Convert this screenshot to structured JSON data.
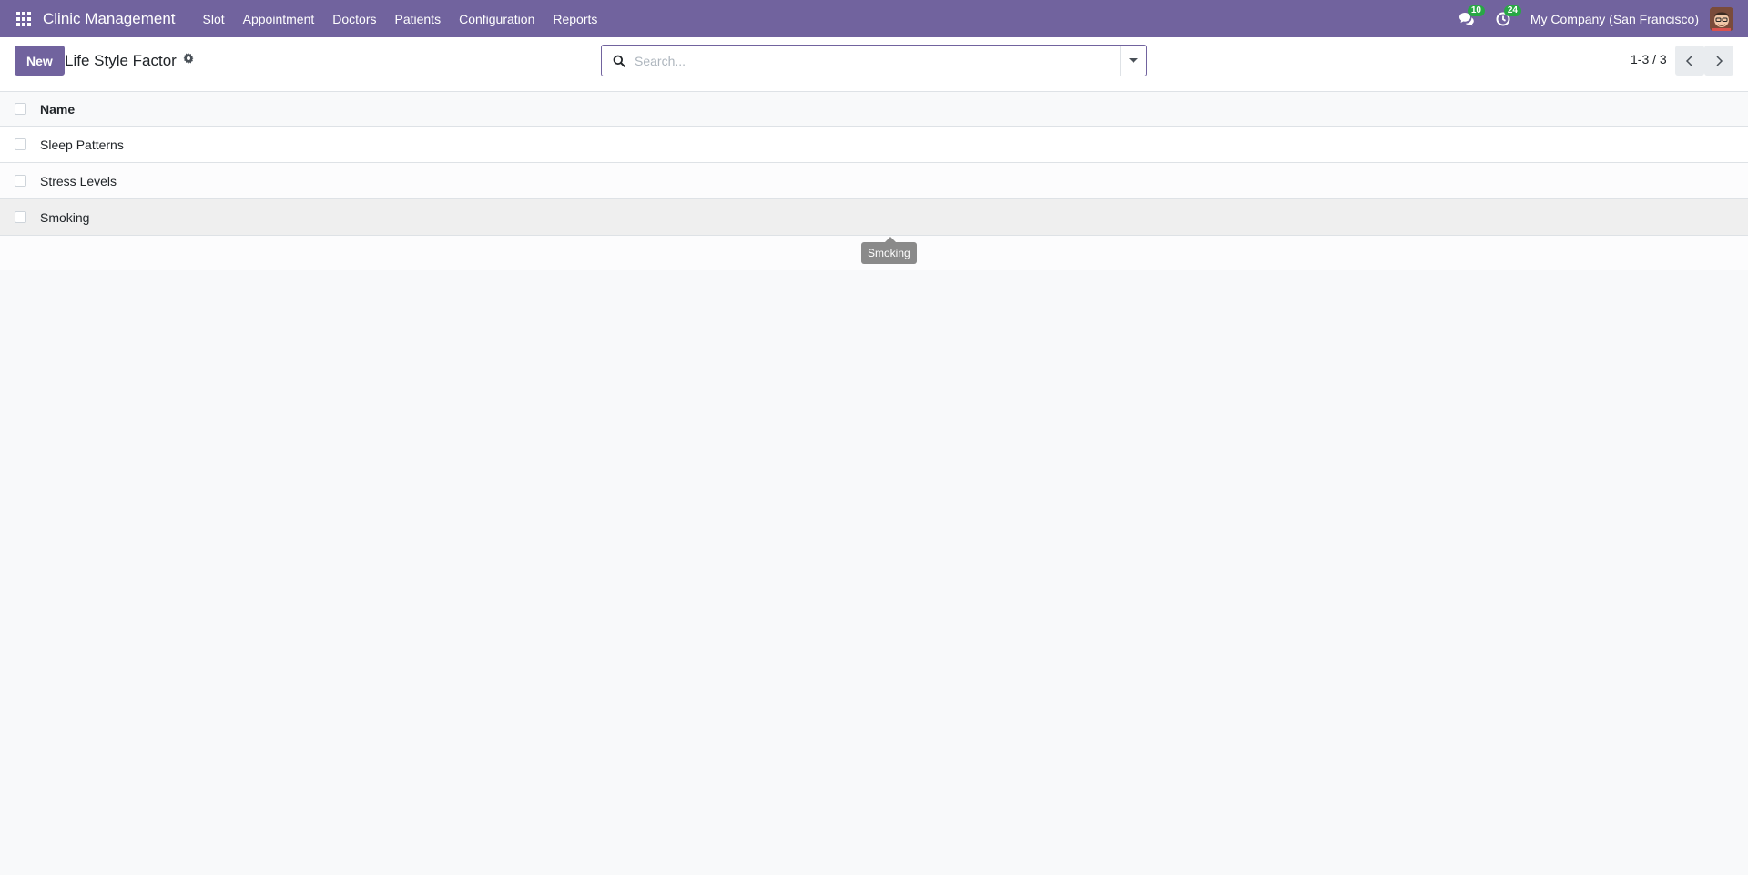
{
  "navbar": {
    "brand": "Clinic Management",
    "menu": [
      "Slot",
      "Appointment",
      "Doctors",
      "Patients",
      "Configuration",
      "Reports"
    ],
    "messages_badge": "10",
    "activities_badge": "24",
    "company": "My Company (San Francisco)",
    "color": "#71639e"
  },
  "control_panel": {
    "new_label": "New",
    "title": "Life Style Factor",
    "search_placeholder": "Search...",
    "pager_value": "1-3 / 3"
  },
  "list": {
    "columns": [
      "Name"
    ],
    "rows": [
      "Sleep Patterns",
      "Stress Levels",
      "Smoking"
    ]
  },
  "tooltip": {
    "text": "Smoking"
  },
  "colors": {
    "primary": "#71639e",
    "badge": "#28a745"
  }
}
